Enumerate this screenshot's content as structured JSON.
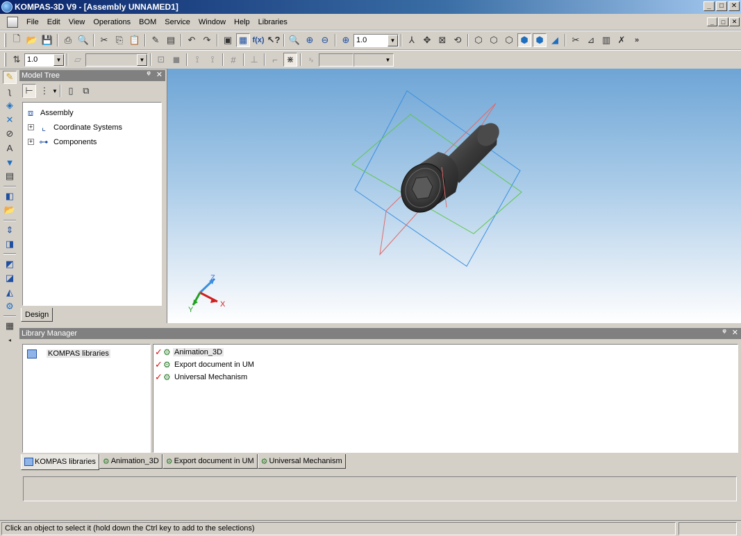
{
  "window": {
    "title": "KOMPAS-3D V9 - [Assembly UNNAMED1]",
    "minimize": "_",
    "maximize": "□",
    "close": "✕"
  },
  "menu": [
    {
      "label": "File"
    },
    {
      "label": "Edit"
    },
    {
      "label": "View"
    },
    {
      "label": "Operations"
    },
    {
      "label": "BOM"
    },
    {
      "label": "Service"
    },
    {
      "label": "Window"
    },
    {
      "label": "Help"
    },
    {
      "label": "Libraries"
    }
  ],
  "toolbar1": {
    "zoom_value": "1.0"
  },
  "toolbar2": {
    "step_value": "1.0",
    "fx_label": "f(x)"
  },
  "model_tree": {
    "title": "Model Tree",
    "pin": "ᵠ",
    "close": "✕",
    "items": [
      {
        "label": "Assembly"
      },
      {
        "label": "Coordinate Systems",
        "expander": "+"
      },
      {
        "label": "Components",
        "expander": "+"
      }
    ],
    "tab_label": "Design"
  },
  "viewport": {
    "axis_x": "X",
    "axis_y": "Y",
    "axis_z": "Z"
  },
  "library_manager": {
    "title": "Library Manager",
    "pin": "ᵠ",
    "close": "✕",
    "root": "KOMPAS libraries",
    "libraries": [
      {
        "label": "Animation_3D"
      },
      {
        "label": "Export document in UM"
      },
      {
        "label": "Universal Mechanism"
      }
    ],
    "tabs": [
      {
        "label": "KOMPAS libraries"
      },
      {
        "label": "Animation_3D"
      },
      {
        "label": "Export document in UM"
      },
      {
        "label": "Universal Mechanism"
      }
    ]
  },
  "status": {
    "text": "Click an object to select it (hold down the Ctrl key to add to the selections)"
  },
  "colors": {
    "title_gradient_start": "#0a246a",
    "viewport_top": "#6ea5d6",
    "plane_blue": "#3a8fe0",
    "plane_green": "#5fc64a",
    "plane_red": "#e06a6a"
  }
}
